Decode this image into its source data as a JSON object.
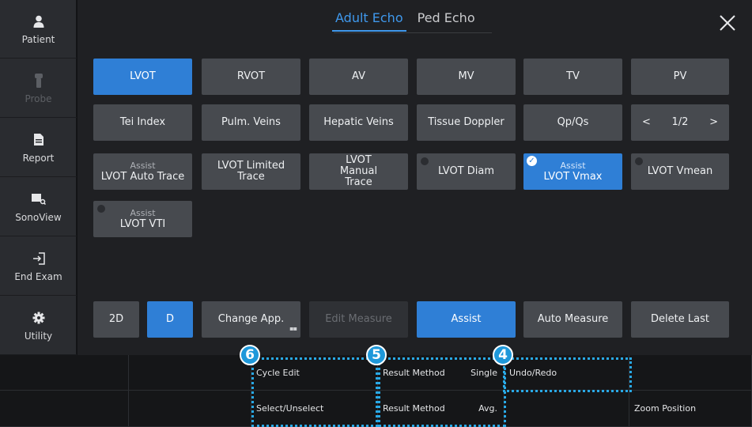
{
  "sidebar": {
    "items": [
      {
        "label": "Patient",
        "icon": "person-icon"
      },
      {
        "label": "Probe",
        "icon": "probe-icon"
      },
      {
        "label": "Report",
        "icon": "report-icon"
      },
      {
        "label": "SonoView",
        "icon": "sonoview-icon"
      },
      {
        "label": "End Exam",
        "icon": "end-exam-icon"
      },
      {
        "label": "Utility",
        "icon": "gear-icon"
      }
    ]
  },
  "tabs": [
    "Adult Echo",
    "Ped Echo"
  ],
  "grid": {
    "row1": [
      "LVOT",
      "RVOT",
      "AV",
      "MV",
      "TV",
      "PV"
    ],
    "row2": [
      "Tei Index",
      "Pulm. Veins",
      "Hepatic Veins",
      "Tissue Doppler",
      "Qp/Qs"
    ],
    "pager": {
      "prev": "<",
      "page": "1/2",
      "next": ">"
    },
    "row3": [
      {
        "sub": "Assist",
        "label": "LVOT Auto Trace"
      },
      {
        "label": "LVOT Limited Trace"
      },
      {
        "label": "LVOT Manual Trace"
      },
      {
        "label": "LVOT Diam"
      },
      {
        "sub": "Assist",
        "label": "LVOT Vmax"
      },
      {
        "label": "LVOT Vmean"
      }
    ],
    "row4": [
      {
        "sub": "Assist",
        "label": "LVOT VTI"
      }
    ]
  },
  "toolbar": {
    "mode_2d": "2D",
    "mode_d": "D",
    "change_app": "Change App.",
    "edit_measure": "Edit Measure",
    "assist": "Assist",
    "auto_measure": "Auto Measure",
    "delete_last": "Delete Last"
  },
  "bottom": {
    "cycle_edit": "Cycle Edit",
    "select_unselect": "Select/Unselect",
    "result_method_1": "Result Method",
    "result_value_1": "Single",
    "result_method_2": "Result Method",
    "result_value_2": "Avg.",
    "undo_redo": "Undo/Redo",
    "zoom_position": "Zoom Position"
  },
  "callouts": [
    "6",
    "5",
    "4"
  ],
  "colors": {
    "accent": "#2f7fd6",
    "callout": "#29a9e6"
  }
}
